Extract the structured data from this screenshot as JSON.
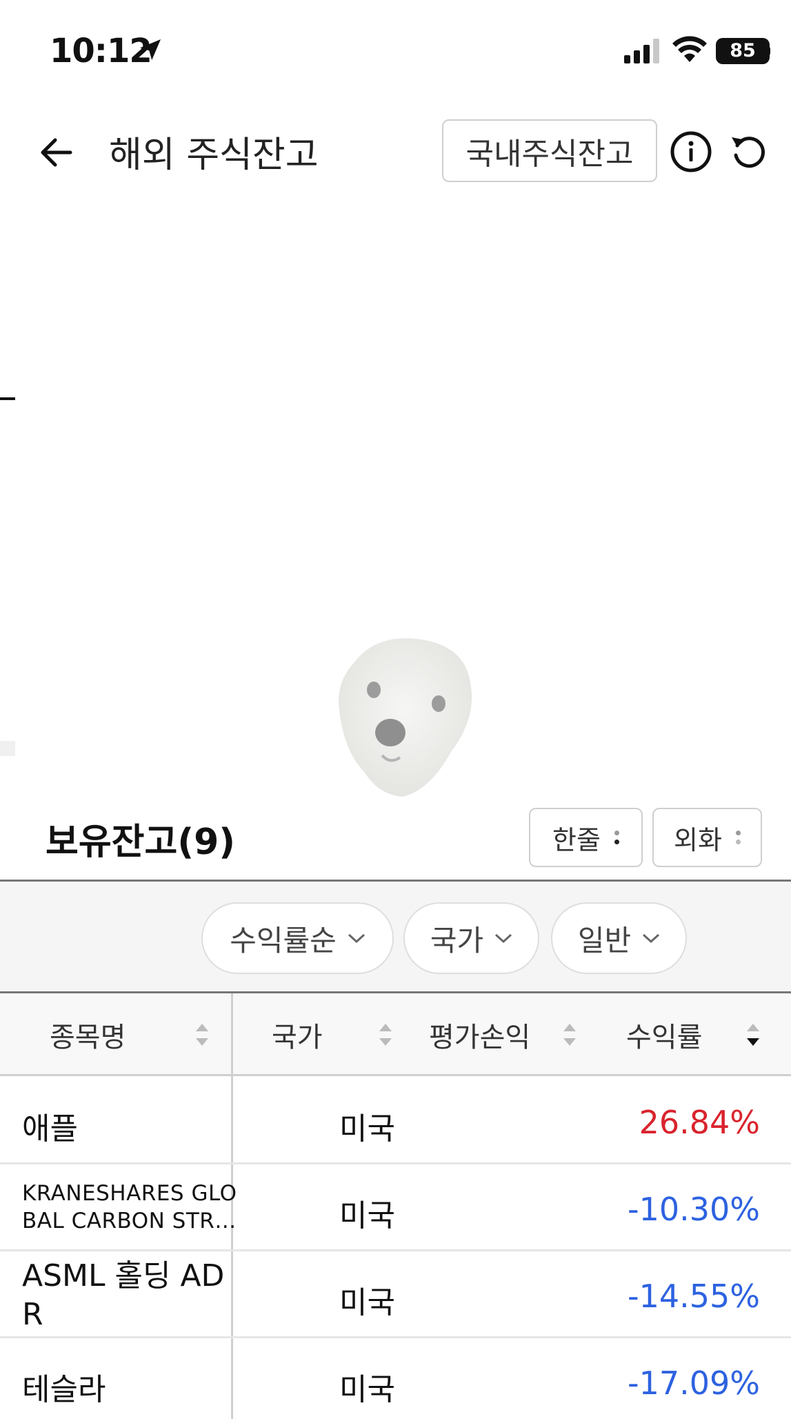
{
  "status_bar": {
    "time": "10:12",
    "battery": "85"
  },
  "header": {
    "title": "해외 주식잔고",
    "domestic_button": "국내주식잔고"
  },
  "holdings": {
    "title": "보유잔고(9)",
    "view_toggle": "한줄",
    "currency_toggle": "외화"
  },
  "filters": [
    {
      "label": "수익률순"
    },
    {
      "label": "국가"
    },
    {
      "label": "일반"
    }
  ],
  "table": {
    "columns": [
      "종목명",
      "국가",
      "평가손익",
      "수익률"
    ],
    "rows": [
      {
        "name": "애플",
        "country": "미국",
        "rate": "26.84%",
        "sign": "pos"
      },
      {
        "name": "KRANESHARES GLOBAL CARBON STR…",
        "name_line1": "KRANESHARES GLO",
        "name_line2": "BAL CARBON STR…",
        "country": "미국",
        "rate": "-10.30%",
        "sign": "neg"
      },
      {
        "name_line1": "ASML 홀딩 AD",
        "name_line2": "R",
        "country": "미국",
        "rate": "-14.55%",
        "sign": "neg"
      },
      {
        "name": "테슬라",
        "country": "미국",
        "rate": "-17.09%",
        "sign": "neg"
      }
    ]
  },
  "colors": {
    "positive": "#d9232d",
    "negative": "#2d62e0"
  }
}
